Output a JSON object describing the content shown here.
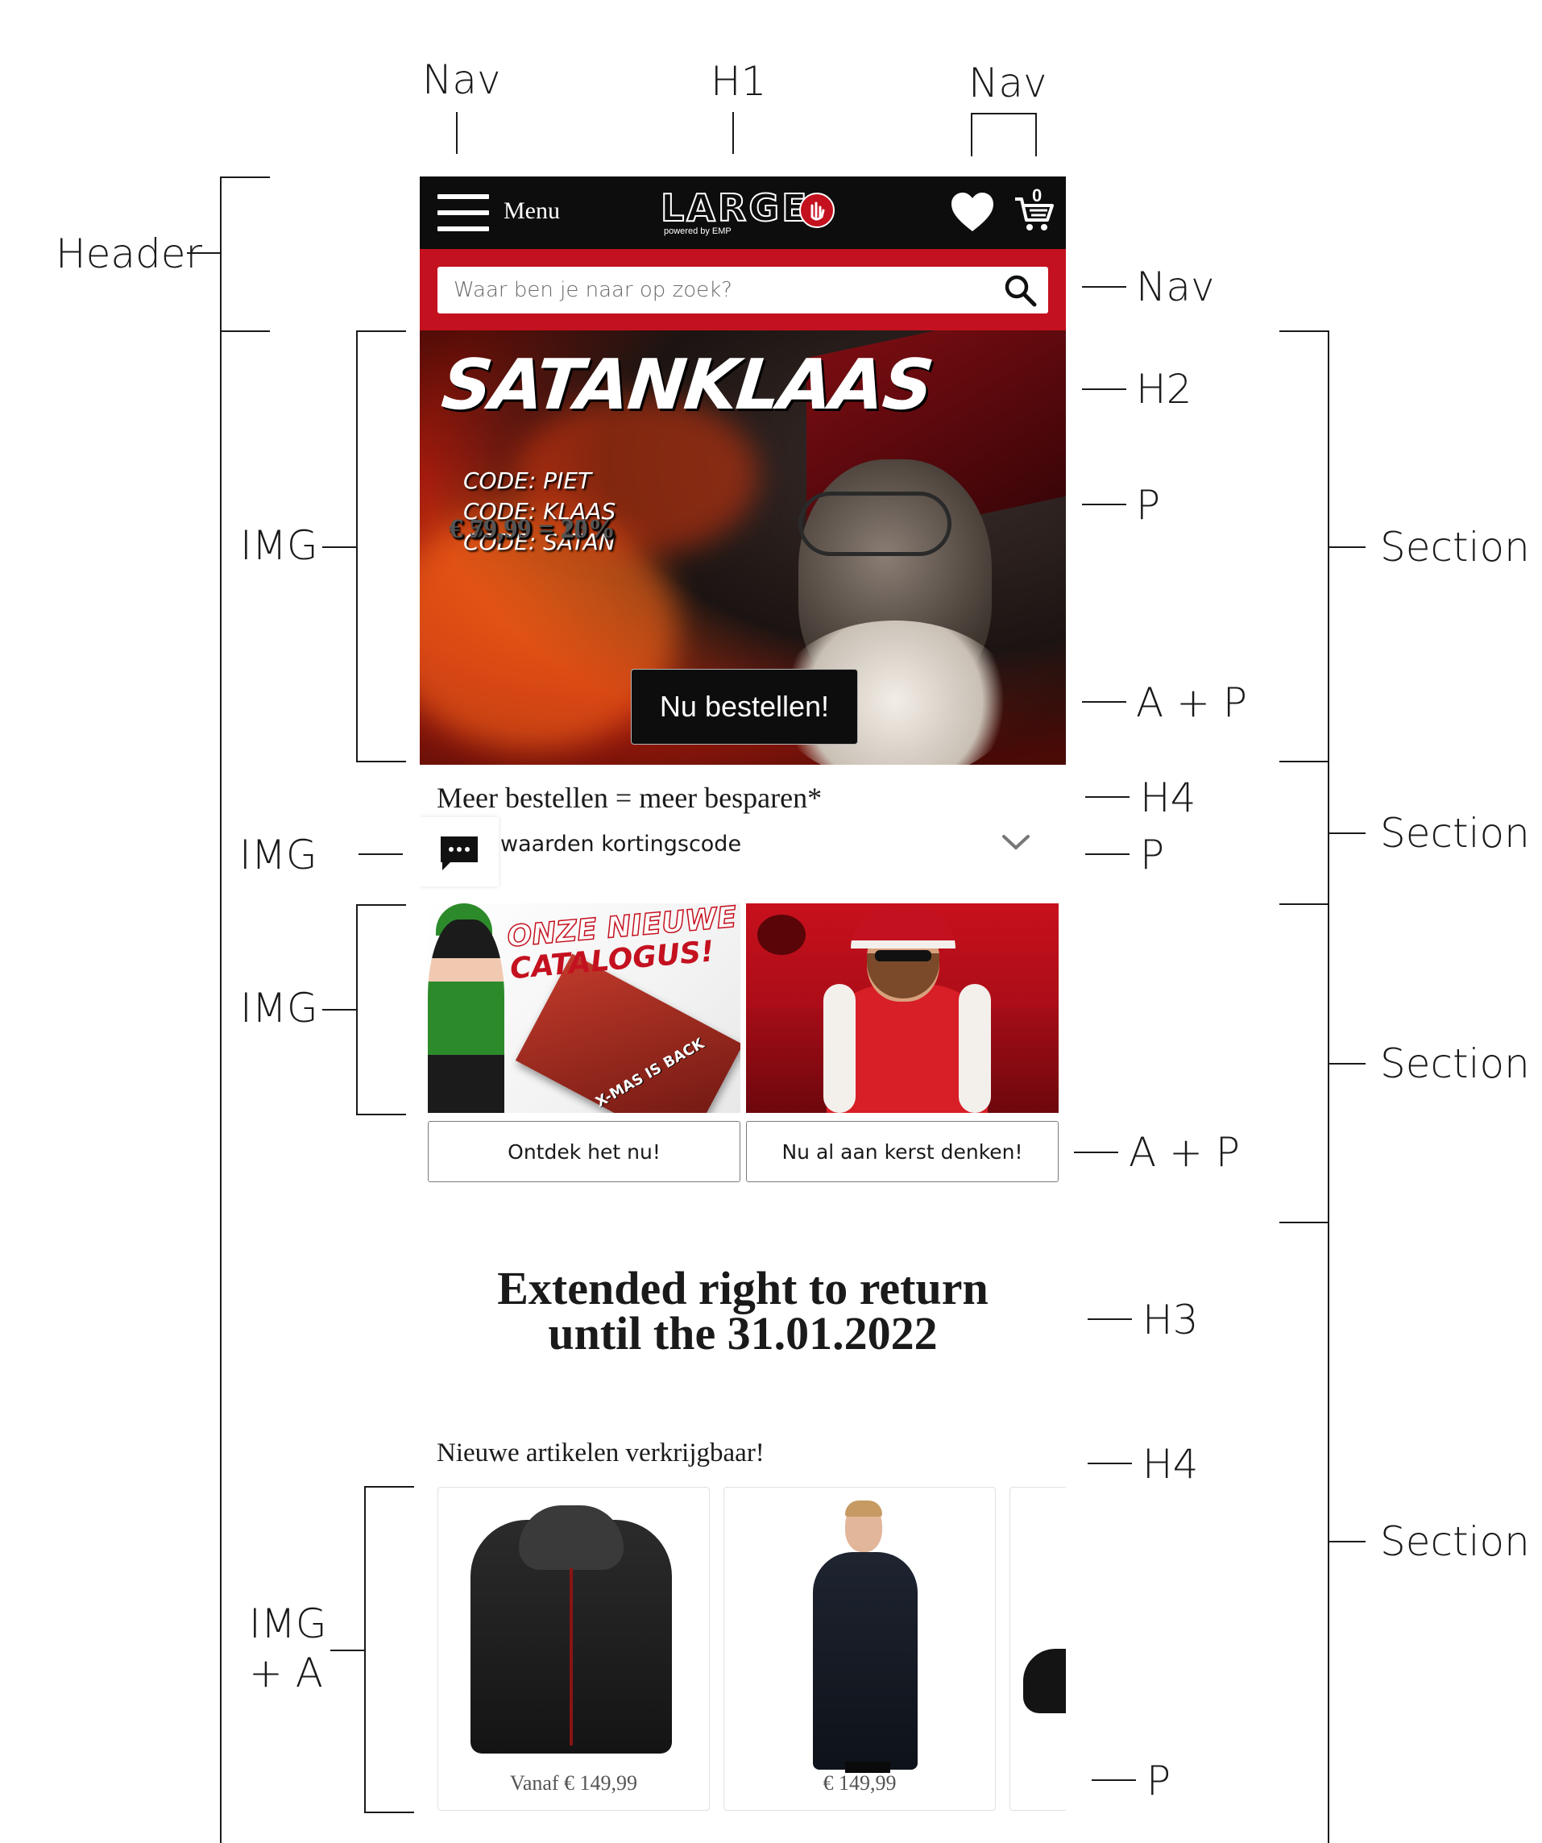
{
  "annotations": {
    "top_nav_left": "Nav",
    "top_h1": "H1",
    "top_nav_right": "Nav",
    "header": "Header",
    "img_hero": "IMG",
    "img_chat": "IMG",
    "img_tiles": "IMG",
    "img_products_1": "IMG",
    "img_products_2": "+ A",
    "nav_search": "Nav",
    "h2": "H2",
    "p_hero": "P",
    "a_p_hero": "A + P",
    "h4_more": "H4",
    "p_acc": "P",
    "a_p_tiles": "A + P",
    "h3": "H3",
    "h4_new": "H4",
    "p_price": "P",
    "section_1": "Section",
    "section_2": "Section",
    "section_3": "Section",
    "section_4": "Section"
  },
  "header": {
    "menu_label": "Menu",
    "logo_text": "LARGE",
    "logo_sub": "powered by EMP",
    "cart_count": "0",
    "icons": {
      "menu": "hamburger-icon",
      "wishlist": "heart-icon",
      "cart": "cart-icon",
      "search": "search-icon"
    }
  },
  "search": {
    "placeholder": "Waar ben je naar op zoek?"
  },
  "hero": {
    "title": "SATANKLAAS",
    "offers": [
      {
        "price": "€ 39,99 = 10%",
        "code": "CODE: PIET"
      },
      {
        "price": "€ 59,99 = 15%",
        "code": "CODE: KLAAS"
      },
      {
        "price": "€ 79,99 = 20%",
        "code": "CODE: SATAN"
      }
    ],
    "button": "Nu bestellen!"
  },
  "discount": {
    "heading": "Meer bestellen = meer besparen*",
    "accordion_text": "waarden kortingscode",
    "chat_icon": "chat-icon",
    "chevron_icon": "chevron-down-icon"
  },
  "tiles": [
    {
      "image_text_1": "ONZE NIEUWE",
      "image_text_2": "CATALOGUS!",
      "image_text_3": "X-MAS IS BACK",
      "button": "Ontdek het nu!"
    },
    {
      "button": "Nu al aan kerst denken!"
    }
  ],
  "return_heading": {
    "line1": "Extended right to return",
    "line2": "until the 31.01.2022"
  },
  "new_items": {
    "heading": "Nieuwe artikelen verkrijgbaar!",
    "products": [
      {
        "price": "Vanaf € 149,99"
      },
      {
        "price": "€ 149,99"
      }
    ]
  }
}
